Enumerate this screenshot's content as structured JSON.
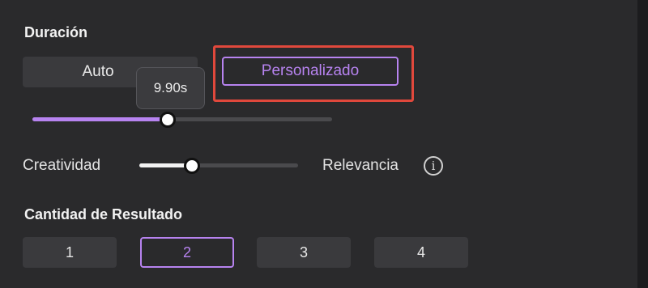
{
  "duration": {
    "title": "Duración",
    "modes": [
      {
        "label": "Auto",
        "selected": false
      },
      {
        "label": "Personalizado",
        "selected": true
      }
    ],
    "value_label": "9.90s",
    "slider_fraction": 0.45
  },
  "balance": {
    "left_label": "Creatividad",
    "right_label": "Relevancia",
    "slider_fraction": 0.33,
    "info_icon": "info-icon",
    "info_glyph": "i"
  },
  "results": {
    "title": "Cantidad de Resultado",
    "options": [
      "1",
      "2",
      "3",
      "4"
    ],
    "selected": "2"
  },
  "colors": {
    "accent": "#b783f0",
    "highlight": "#e0483c",
    "panel": "#2a2a2c"
  }
}
